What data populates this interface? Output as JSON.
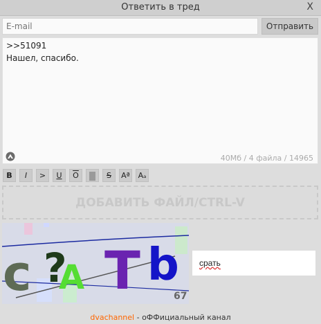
{
  "window": {
    "title": "Ответить в тред",
    "close_label": "X"
  },
  "form": {
    "email_placeholder": "E-mail",
    "send_label": "Отправить",
    "message_line1": ">>51091",
    "message_line2": "Нашел, спасибо.",
    "counter": "40Мб / 4 файла / 14965"
  },
  "toolbar": {
    "bold": "B",
    "italic": "I",
    "quote": ">",
    "underline": "U",
    "overline": "O",
    "spoiler": "",
    "strike": "S",
    "sup": "Aª",
    "sub": "Aₐ"
  },
  "dropzone": {
    "label": "ДОБАВИТЬ ФАЙЛ/CTRL-V"
  },
  "captcha": {
    "answer": "срать",
    "corner_number": "67"
  },
  "footer": {
    "link": "dvachannel",
    "text": " - оФФициальный канал"
  },
  "icons": {
    "uploader": "triangle-logo-icon"
  }
}
